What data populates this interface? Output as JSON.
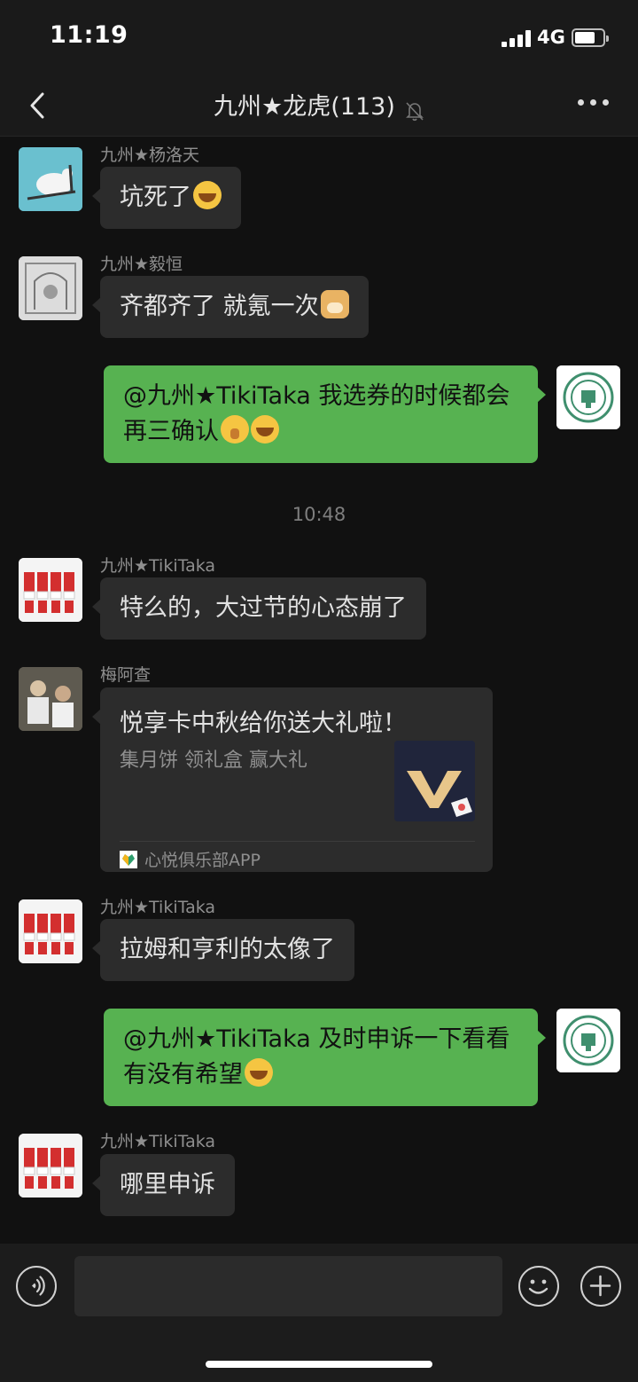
{
  "status_bar": {
    "time": "11:19",
    "network": "4G"
  },
  "header": {
    "title": "九州★龙虎(113)"
  },
  "messages": [
    {
      "sender": "九州★杨洛天",
      "text": "坑死了"
    },
    {
      "sender": "九州★毅恒",
      "text": "齐都齐了 就氪一次"
    },
    {
      "mine": true,
      "text": "@九州★TikiTaka 我选券的时候都会再三确认"
    },
    {
      "timestamp": "10:48"
    },
    {
      "sender": "九州★TikiTaka",
      "text": "特么的，大过节的心态崩了"
    },
    {
      "sender": "梅阿查",
      "card": {
        "title": "悦享卡中秋给你送大礼啦！",
        "description": "集月饼 领礼盒 赢大礼",
        "source": "心悦俱乐部APP"
      }
    },
    {
      "sender": "九州★TikiTaka",
      "text": "拉姆和亨利的太像了"
    },
    {
      "mine": true,
      "text": "@九州★TikiTaka 及时申诉一下看看有没有希望"
    },
    {
      "sender": "九州★TikiTaka",
      "text": "哪里申诉"
    }
  ],
  "icons": {
    "back": "back-icon",
    "mute": "bell-slash-icon",
    "more": "more-icon",
    "voice": "voice-icon",
    "emoji": "emoji-icon",
    "add": "plus-icon"
  },
  "colors": {
    "background": "#111111",
    "my_bubble": "#57b251",
    "other_bubble": "#2c2c2c"
  }
}
